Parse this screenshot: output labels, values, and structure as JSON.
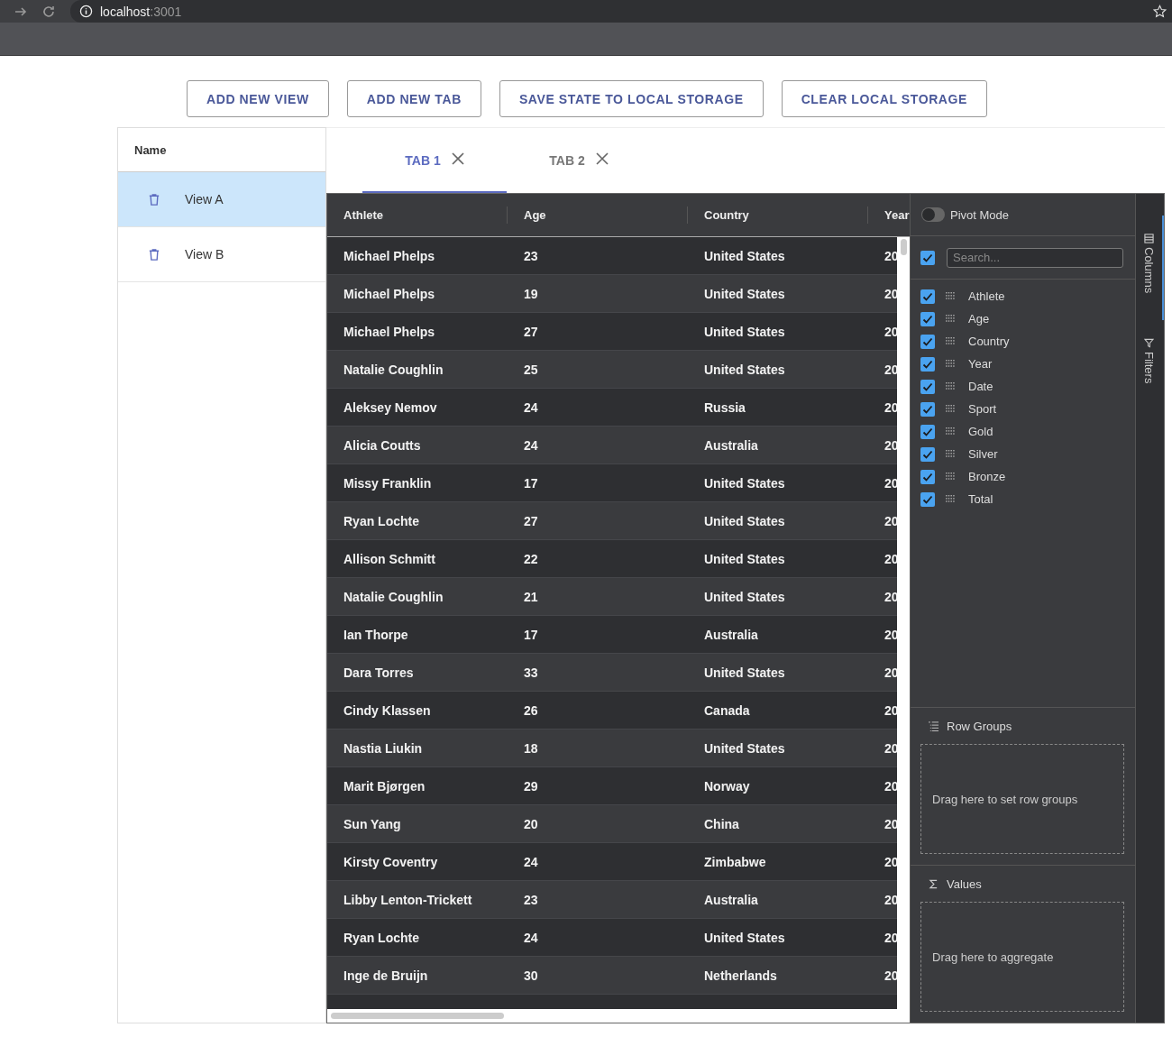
{
  "browser": {
    "host": "localhost",
    "port": ":3001"
  },
  "toolbar_buttons": [
    "ADD NEW VIEW",
    "ADD NEW TAB",
    "SAVE STATE TO LOCAL STORAGE",
    "CLEAR LOCAL STORAGE"
  ],
  "views_panel": {
    "header": "Name",
    "items": [
      {
        "label": "View A",
        "selected": true
      },
      {
        "label": "View B",
        "selected": false
      }
    ]
  },
  "tabs": [
    {
      "label": "TAB 1",
      "selected": true
    },
    {
      "label": "TAB 2",
      "selected": false
    }
  ],
  "grid": {
    "columns": [
      "Athlete",
      "Age",
      "Country",
      "Year"
    ],
    "rows": [
      [
        "Michael Phelps",
        "23",
        "United States",
        "20"
      ],
      [
        "Michael Phelps",
        "19",
        "United States",
        "20"
      ],
      [
        "Michael Phelps",
        "27",
        "United States",
        "20"
      ],
      [
        "Natalie Coughlin",
        "25",
        "United States",
        "20"
      ],
      [
        "Aleksey Nemov",
        "24",
        "Russia",
        "20"
      ],
      [
        "Alicia Coutts",
        "24",
        "Australia",
        "20"
      ],
      [
        "Missy Franklin",
        "17",
        "United States",
        "20"
      ],
      [
        "Ryan Lochte",
        "27",
        "United States",
        "20"
      ],
      [
        "Allison Schmitt",
        "22",
        "United States",
        "20"
      ],
      [
        "Natalie Coughlin",
        "21",
        "United States",
        "20"
      ],
      [
        "Ian Thorpe",
        "17",
        "Australia",
        "20"
      ],
      [
        "Dara Torres",
        "33",
        "United States",
        "20"
      ],
      [
        "Cindy Klassen",
        "26",
        "Canada",
        "20"
      ],
      [
        "Nastia Liukin",
        "18",
        "United States",
        "20"
      ],
      [
        "Marit Bjørgen",
        "29",
        "Norway",
        "20"
      ],
      [
        "Sun Yang",
        "20",
        "China",
        "20"
      ],
      [
        "Kirsty Coventry",
        "24",
        "Zimbabwe",
        "20"
      ],
      [
        "Libby Lenton-Trickett",
        "23",
        "Australia",
        "20"
      ],
      [
        "Ryan Lochte",
        "24",
        "United States",
        "20"
      ],
      [
        "Inge de Bruijn",
        "30",
        "Netherlands",
        "20"
      ]
    ]
  },
  "side_panel": {
    "pivot_mode": {
      "label": "Pivot Mode",
      "on": false
    },
    "select_all": {
      "checked": true
    },
    "search": {
      "placeholder": "Search..."
    },
    "columns": [
      {
        "label": "Athlete",
        "checked": true
      },
      {
        "label": "Age",
        "checked": true
      },
      {
        "label": "Country",
        "checked": true
      },
      {
        "label": "Year",
        "checked": true
      },
      {
        "label": "Date",
        "checked": true
      },
      {
        "label": "Sport",
        "checked": true
      },
      {
        "label": "Gold",
        "checked": true
      },
      {
        "label": "Silver",
        "checked": true
      },
      {
        "label": "Bronze",
        "checked": true
      },
      {
        "label": "Total",
        "checked": true
      }
    ],
    "row_groups": {
      "title": "Row Groups",
      "hint": "Drag here to set row groups"
    },
    "values": {
      "title": "Values",
      "hint": "Drag here to aggregate"
    }
  },
  "side_tabs": [
    {
      "label": "Columns",
      "selected": true
    },
    {
      "label": "Filters",
      "selected": false
    }
  ]
}
